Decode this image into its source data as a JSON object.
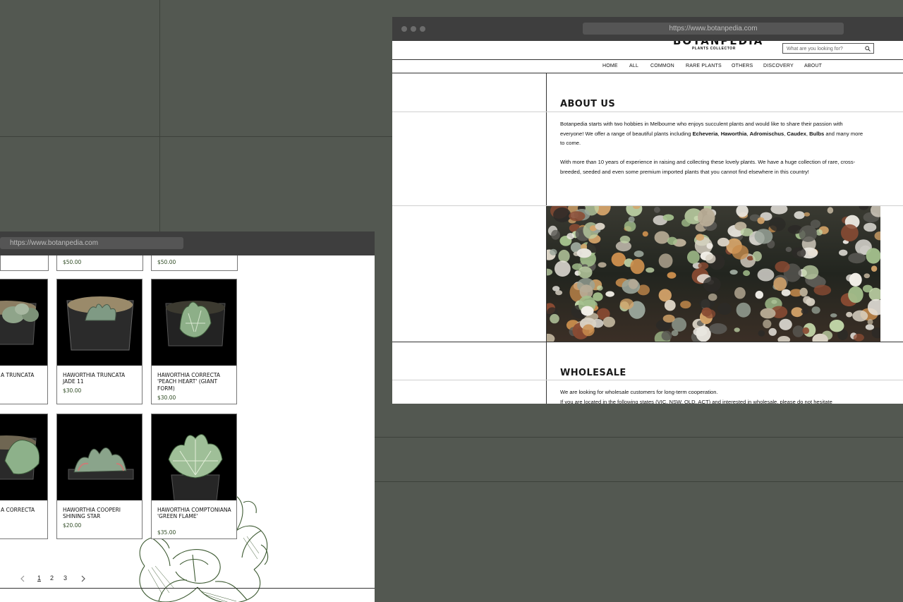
{
  "colors": {
    "background": "#535851",
    "price": "#2e4a23",
    "window_bar": "#3e3e3e"
  },
  "right_window": {
    "url": "https://www.botanpedia.com",
    "logo": "BOTANPEDIA",
    "tagline": "PLANTS COLLECTOR",
    "search_placeholder": "What are you looking for?",
    "nav": [
      "HOME",
      "ALL",
      "COMMON",
      "RARE PLANTS",
      "OTHERS",
      "DISCOVERY",
      "ABOUT"
    ],
    "about": {
      "heading": "ABOUT US",
      "p1_a": "Botanpedia starts with two hobbies in Melbourne who enjoys succulent plants and would like to share their passion with everyone! We offer a range of beautiful plants including ",
      "p1_b1": "Echeveria",
      "p1_sep1": ", ",
      "p1_b2": "Haworthia",
      "p1_sep2": ", ",
      "p1_b3": "Adromischus",
      "p1_sep3": ", ",
      "p1_b4": "Caudex",
      "p1_sep4": ", ",
      "p1_b5": "Bulbs",
      "p1_c": " and many more to come.",
      "p2": "With more than 10 years of experience in raising and collecting these lovely plants. We have a huge collection of rare, cross-breeded, seeded and even some premium imported plants that you cannot find elsewhere in this country!"
    },
    "wholesale": {
      "heading": "WHOLESALE",
      "p1": "We are looking for wholesale customers for long-term cooperation.",
      "p2": "If you are located in the following states (VIC, NSW, QLD, ACT) and interested in wholesale, please do not hesitate"
    }
  },
  "left_window": {
    "url": "https://www.botanpedia.com",
    "top_prices": [
      "$50.00",
      "$50.00"
    ],
    "products": [
      {
        "name": "A TRUNCATA",
        "price": ""
      },
      {
        "name": "HAWORTHIA TRUNCATA JADE 11",
        "price": "$30.00"
      },
      {
        "name": "HAWORTHIA CORRECTA 'PEACH HEART' (GIANT FORM)",
        "price": "$30.00"
      },
      {
        "name": "A CORRECTA",
        "price": ""
      },
      {
        "name": "HAWORTHIA COOPERI SHINING STAR",
        "price": "$20.00"
      },
      {
        "name": "HAWORTHIA COMPTONIANA 'GREEN FLAME'",
        "price": "$35.00"
      }
    ],
    "pagination": {
      "pages": [
        "1",
        "2",
        "3"
      ],
      "current": "1",
      "prev_icon": "chevron-left-icon",
      "next_icon": "chevron-right-icon"
    }
  }
}
